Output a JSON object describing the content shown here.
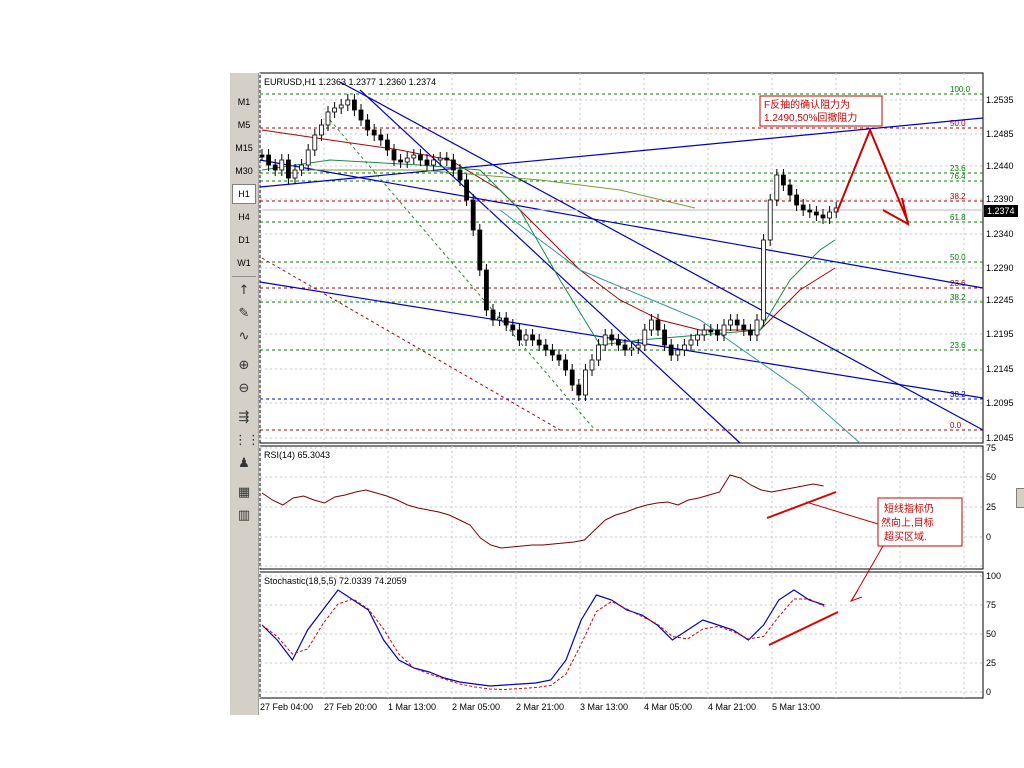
{
  "timeframes": [
    "M1",
    "M5",
    "M15",
    "M30",
    "H1",
    "H4",
    "D1",
    "W1"
  ],
  "selected_timeframe": "H1",
  "tool_icons": [
    {
      "name": "cursor-icon",
      "glyph": "↑"
    },
    {
      "name": "pencil-icon",
      "glyph": "✎"
    },
    {
      "name": "wave-icon",
      "glyph": "∿"
    },
    {
      "name": "zoom-in-icon",
      "glyph": "⊕"
    },
    {
      "name": "zoom-out-icon",
      "glyph": "⊖"
    },
    {
      "name": "autoscroll-icon",
      "glyph": "⇶"
    },
    {
      "name": "chart-shift-icon",
      "glyph": "⋮⋮"
    },
    {
      "name": "period-separator-icon",
      "glyph": "♟"
    },
    {
      "name": "bar-chart-icon",
      "glyph": "▦"
    },
    {
      "name": "candle-chart-icon",
      "glyph": "▥"
    }
  ],
  "main_chart": {
    "header": "EURUSD,H1  1.2363 1.2377 1.2360 1.2374",
    "current_price": "1.2374",
    "price_ticks": [
      "1.2535",
      "1.2485",
      "1.2440",
      "1.2390",
      "1.2340",
      "1.2290",
      "1.2245",
      "1.2195",
      "1.2145",
      "1.2095",
      "1.2045"
    ],
    "fib_labels_right": [
      "100.0",
      "50.0",
      "76.4",
      "23.6",
      "38.2",
      "61.8",
      "50.0",
      "23.6",
      "38.2",
      "23.6",
      "38.2",
      "0.0"
    ],
    "annotation": [
      "F反抽的确认阻力为",
      "1.2490,50%回撤阻力"
    ]
  },
  "rsi_panel": {
    "header": "RSI(14) 65.3043",
    "ticks": [
      "75",
      "50",
      "25",
      "0"
    ],
    "annotation": [
      "短线指标仍",
      "然向上,目标",
      "超买区域."
    ]
  },
  "stoch_panel": {
    "header": "Stochastic(18,5,5)  72.0339  74.2059",
    "ticks": [
      "100",
      "75",
      "50",
      "25",
      "0"
    ]
  },
  "time_labels": [
    "27 Feb 04:00",
    "27 Feb 20:00",
    "1 Mar 13:00",
    "2 Mar 05:00",
    "2 Mar 21:00",
    "3 Mar 13:00",
    "4 Mar 05:00",
    "4 Mar 21:00",
    "5 Mar 13:00"
  ],
  "colors": {
    "grid": "#c8c8c8",
    "candle": "#000000",
    "trend": "#0000cc",
    "fib_red": "#b00000",
    "fib_green": "#008000",
    "annot": "#d00000",
    "rsi": "#800000",
    "stoch_main": "#0000cc",
    "stoch_signal": "#e00000"
  }
}
